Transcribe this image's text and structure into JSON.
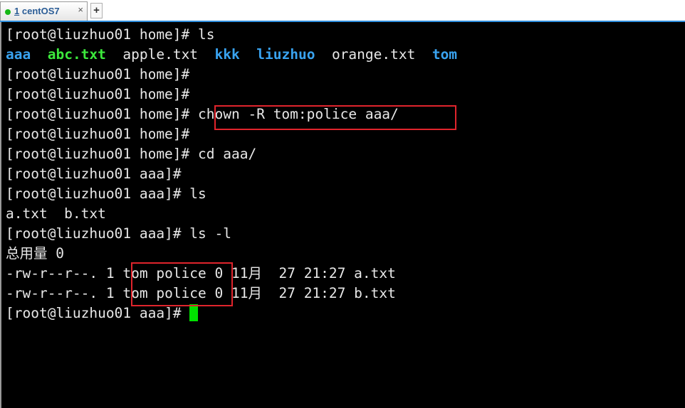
{
  "tab": {
    "number": "1",
    "title": "centOS7",
    "close": "×",
    "new_tab": "+"
  },
  "terminal": {
    "l1": "[root@liuzhuo01 home]# ls",
    "ls_items": [
      "aaa",
      "abc.txt",
      "apple.txt",
      "kkk",
      "liuzhuo",
      "orange.txt",
      "tom"
    ],
    "l3": "[root@liuzhuo01 home]#",
    "l4": "[root@liuzhuo01 home]#",
    "l5_prompt": "[root@liuzhuo01 home]#",
    "l5_cmd": "chown -R tom:police aaa/",
    "l6": "[root@liuzhuo01 home]#",
    "l7": "[root@liuzhuo01 home]# cd aaa/",
    "l8": "[root@liuzhuo01 aaa]#",
    "l9": "[root@liuzhuo01 aaa]# ls",
    "l10": "a.txt  b.txt",
    "l11": "[root@liuzhuo01 aaa]# ls -l",
    "l12": "总用量 0",
    "l13_pre": "-rw-r--r--. 1",
    "l13_owner": "tom police",
    "l13_post": "0 11月  27 21:27 a.txt",
    "l14_pre": "-rw-r--r--. 1",
    "l14_owner": "tom police",
    "l14_post": "0 11月  27 21:27 b.txt",
    "l15": "[root@liuzhuo01 aaa]#"
  },
  "colors": {
    "directory": "#39a3f0",
    "executable": "#3ce83c",
    "highlight_box": "#e0242c",
    "cursor": "#00e100"
  }
}
